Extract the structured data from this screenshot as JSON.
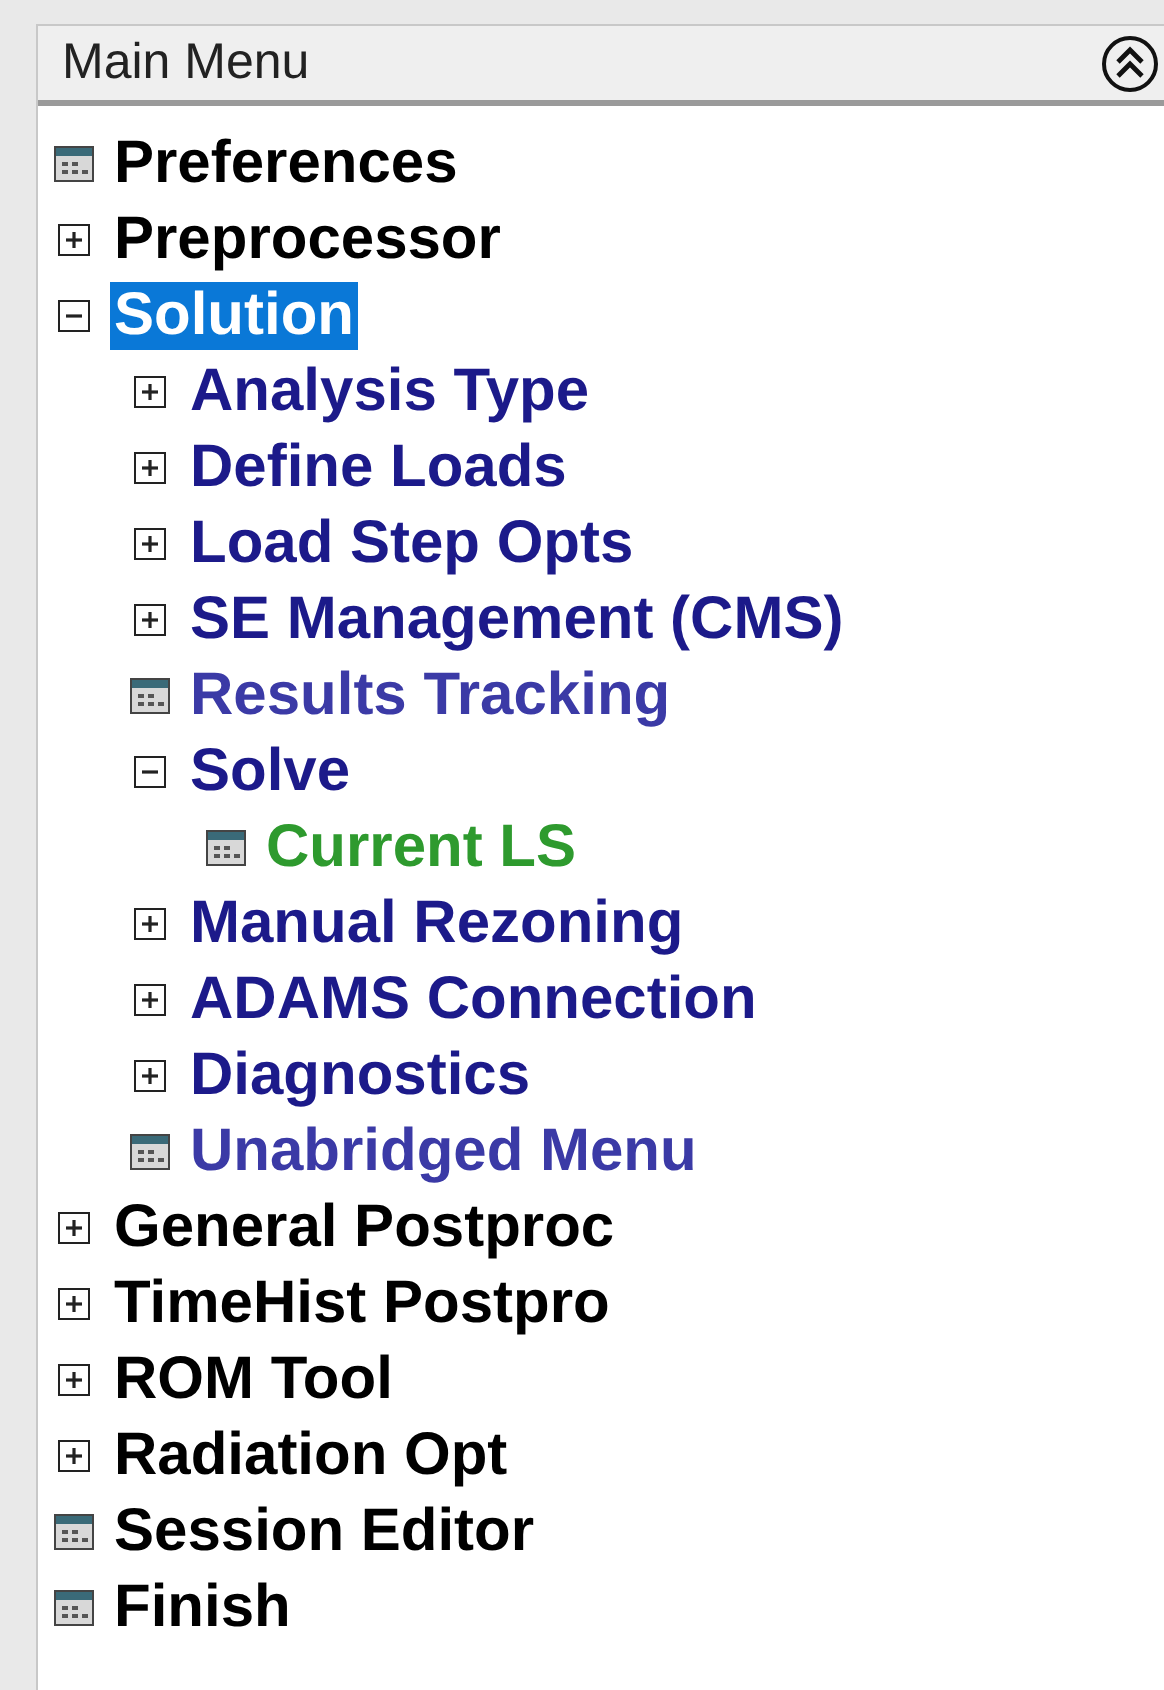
{
  "panel": {
    "title": "Main Menu"
  },
  "tree": [
    {
      "label": "Preferences",
      "kind": "leaf",
      "selected": false,
      "color": "#000000"
    },
    {
      "label": "Preprocessor",
      "kind": "branch",
      "expanded": false,
      "selected": false,
      "color": "#000000"
    },
    {
      "label": "Solution",
      "kind": "branch",
      "expanded": true,
      "selected": true,
      "children": [
        {
          "label": "Analysis Type",
          "kind": "branch",
          "expanded": false,
          "selected": false,
          "color": "#1c1a8a"
        },
        {
          "label": "Define Loads",
          "kind": "branch",
          "expanded": false,
          "selected": false,
          "color": "#1c1a8a"
        },
        {
          "label": "Load Step Opts",
          "kind": "branch",
          "expanded": false,
          "selected": false,
          "color": "#1c1a8a"
        },
        {
          "label": "SE Management (CMS)",
          "kind": "branch",
          "expanded": false,
          "selected": false,
          "color": "#1c1a8a"
        },
        {
          "label": "Results Tracking",
          "kind": "leaf",
          "selected": false,
          "color": "#3b3aa6"
        },
        {
          "label": "Solve",
          "kind": "branch",
          "expanded": true,
          "selected": false,
          "color": "#1c1a8a",
          "children": [
            {
              "label": "Current LS",
              "kind": "leaf",
              "selected": false,
              "color": "#2e9a2e"
            }
          ]
        },
        {
          "label": "Manual Rezoning",
          "kind": "branch",
          "expanded": false,
          "selected": false,
          "color": "#1c1a8a"
        },
        {
          "label": "ADAMS Connection",
          "kind": "branch",
          "expanded": false,
          "selected": false,
          "color": "#1c1a8a"
        },
        {
          "label": "Diagnostics",
          "kind": "branch",
          "expanded": false,
          "selected": false,
          "color": "#1c1a8a"
        },
        {
          "label": "Unabridged Menu",
          "kind": "leaf",
          "selected": false,
          "color": "#3b3aa6"
        }
      ]
    },
    {
      "label": "General Postproc",
      "kind": "branch",
      "expanded": false,
      "selected": false,
      "color": "#000000"
    },
    {
      "label": "TimeHist Postpro",
      "kind": "branch",
      "expanded": false,
      "selected": false,
      "color": "#000000"
    },
    {
      "label": "ROM Tool",
      "kind": "branch",
      "expanded": false,
      "selected": false,
      "color": "#000000"
    },
    {
      "label": "Radiation Opt",
      "kind": "branch",
      "expanded": false,
      "selected": false,
      "color": "#000000"
    },
    {
      "label": "Session Editor",
      "kind": "leaf",
      "selected": false,
      "color": "#000000"
    },
    {
      "label": "Finish",
      "kind": "leaf",
      "selected": false,
      "color": "#000000"
    }
  ]
}
